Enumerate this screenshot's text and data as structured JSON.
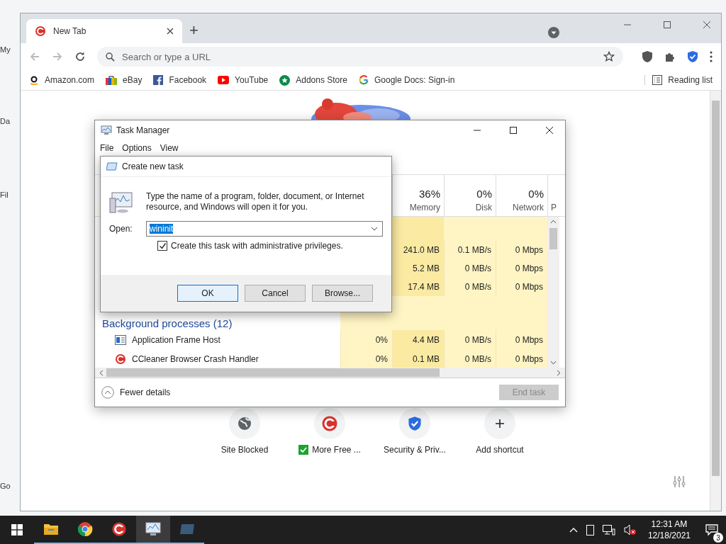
{
  "desktop_icons": [
    {
      "label": "My"
    },
    {
      "label": "Da"
    },
    {
      "label": "Fil"
    },
    {
      "label": "Go"
    }
  ],
  "browser": {
    "tab": {
      "title": "New Tab",
      "selected": true
    },
    "new_tab": "+",
    "address": {
      "placeholder": "Search or type a URL"
    },
    "bookmarks": [
      {
        "label": "Amazon.com",
        "kind": "amazon"
      },
      {
        "label": "eBay",
        "kind": "bag"
      },
      {
        "label": "Facebook",
        "kind": "facebook"
      },
      {
        "label": "YouTube",
        "kind": "play"
      },
      {
        "label": "Addons Store",
        "kind": "star"
      },
      {
        "label": "Google Docs: Sign-in",
        "kind": "google"
      }
    ],
    "reading_list": "Reading list",
    "shortcuts": [
      {
        "label": "Site Blocked",
        "kind": "globe",
        "checked": false
      },
      {
        "label": "More Free ...",
        "kind": "ccleaner",
        "checked": true
      },
      {
        "label": "Security & Priv...",
        "kind": "shield",
        "checked": false
      },
      {
        "label": "Add shortcut",
        "kind": "plus",
        "checked": false
      }
    ]
  },
  "task_manager": {
    "title": "Task Manager",
    "menu": [
      "File",
      "Options",
      "View"
    ],
    "columns": [
      {
        "percent": "36%",
        "label": "Memory"
      },
      {
        "percent": "0%",
        "label": "Disk"
      },
      {
        "percent": "0%",
        "label": "Network"
      },
      {
        "label": "P"
      }
    ],
    "top_rows": [
      {
        "memory": "241.0 MB",
        "disk": "0.1 MB/s",
        "network": "0 Mbps"
      },
      {
        "memory": "5.2 MB",
        "disk": "0 MB/s",
        "network": "0 Mbps"
      },
      {
        "memory": "17.4 MB",
        "disk": "0 MB/s",
        "network": "0 Mbps"
      }
    ],
    "group": "Background processes (12)",
    "rows": [
      {
        "name": "Application Frame Host",
        "kind": "frame",
        "cpu": "0%",
        "memory": "4.4 MB",
        "disk": "0 MB/s",
        "network": "0 Mbps"
      },
      {
        "name": "CCleaner Browser Crash Handler",
        "kind": "ccleaner",
        "cpu": "0%",
        "memory": "0.1 MB",
        "disk": "0 MB/s",
        "network": "0 Mbps"
      }
    ],
    "fewer_details": "Fewer details",
    "end_task": {
      "label": "End task",
      "disabled": true
    }
  },
  "dialog": {
    "title": "Create new task",
    "message": "Type the name of a program, folder, document, or Internet resource, and Windows will open it for you.",
    "open_label": "Open:",
    "open_value": {
      "text": "wininit",
      "selected": true
    },
    "admin": {
      "label": "Create this task with administrative privileges.",
      "checked": true
    },
    "buttons": [
      {
        "label": "OK",
        "default": true
      },
      {
        "label": "Cancel",
        "default": false
      },
      {
        "label": "Browse...",
        "default": false
      }
    ]
  },
  "taskbar": {
    "apps": [
      {
        "kind": "folder",
        "selected": false
      },
      {
        "kind": "chrome",
        "selected": false
      },
      {
        "kind": "ccleaner",
        "selected": false
      },
      {
        "kind": "taskmgr",
        "selected": true
      },
      {
        "kind": "window",
        "selected": false
      }
    ],
    "time": "12:31 AM",
    "date": "12/18/2021",
    "notifications": "3"
  }
}
